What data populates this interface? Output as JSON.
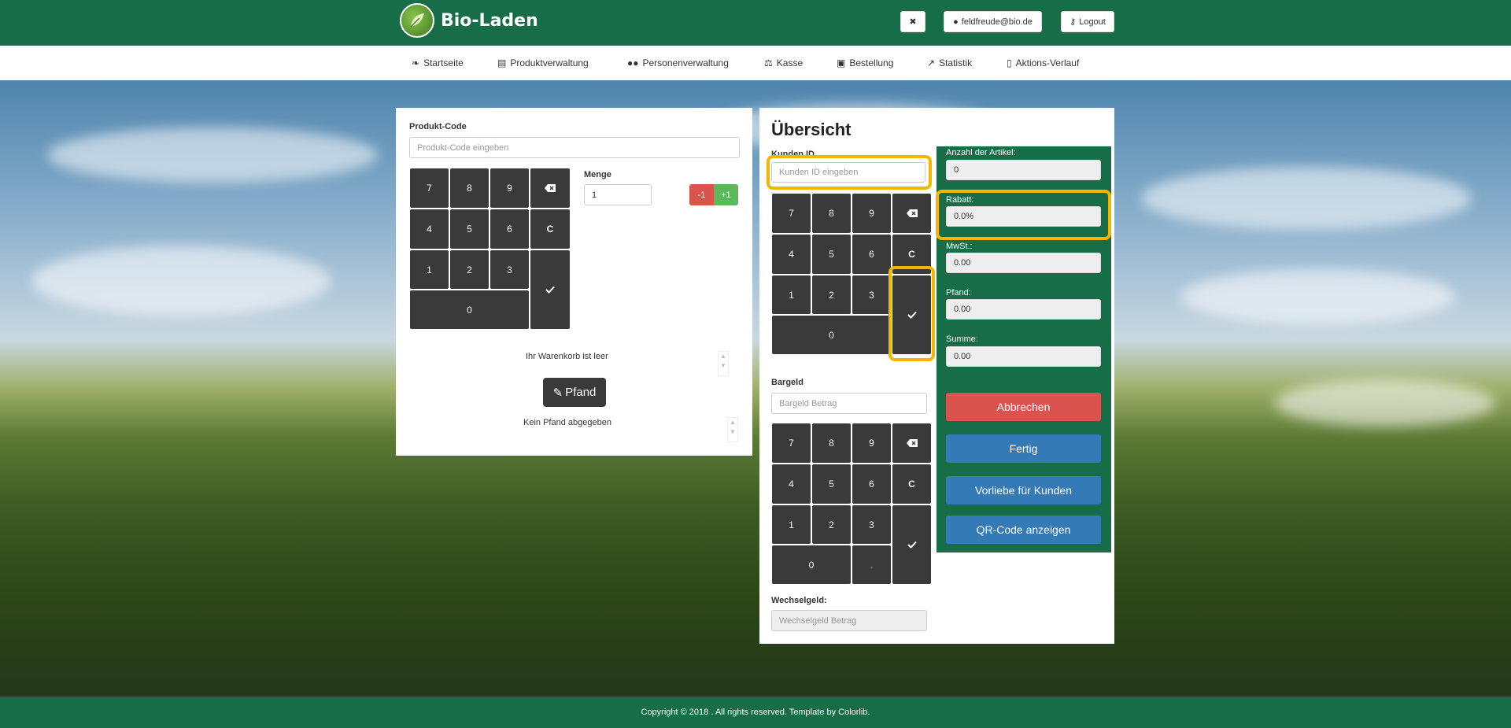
{
  "header": {
    "brand": "Bio-Laden",
    "user_email": "feldfreude@bio.de",
    "logout_label": "Logout"
  },
  "nav": {
    "items": [
      {
        "label": "Startseite",
        "icon": "leaf-icon"
      },
      {
        "label": "Produktverwaltung",
        "icon": "boxes-icon"
      },
      {
        "label": "Personenverwaltung",
        "icon": "users-icon"
      },
      {
        "label": "Kasse",
        "icon": "cash-register-icon"
      },
      {
        "label": "Bestellung",
        "icon": "gift-icon"
      },
      {
        "label": "Statistik",
        "icon": "line-chart-icon"
      },
      {
        "label": "Aktions-Verlauf",
        "icon": "clipboard-icon"
      }
    ]
  },
  "left": {
    "product_code_label": "Produkt-Code",
    "product_code_placeholder": "Produkt-Code eingeben",
    "quantity_label": "Menge",
    "quantity_value": "1",
    "minus_label": "-1",
    "plus_label": "+1",
    "keypad": {
      "k7": "7",
      "k8": "8",
      "k9": "9",
      "k4": "4",
      "k5": "5",
      "k6": "6",
      "kc": "C",
      "k1": "1",
      "k2": "2",
      "k3": "3",
      "k0": "0"
    },
    "cart_empty": "Ihr Warenkorb ist leer",
    "deposit_button": "Pfand",
    "deposit_status": "Kein Pfand abgegeben"
  },
  "mid": {
    "title": "Übersicht",
    "customer_id_label": "Kunden ID",
    "customer_id_placeholder": "Kunden ID eingeben",
    "keypad": {
      "k7": "7",
      "k8": "8",
      "k9": "9",
      "k4": "4",
      "k5": "5",
      "k6": "6",
      "kc": "C",
      "k1": "1",
      "k2": "2",
      "k3": "3",
      "k0": "0"
    },
    "cash_label": "Bargeld",
    "cash_placeholder": "Bargeld Betrag",
    "cash_keypad": {
      "k7": "7",
      "k8": "8",
      "k9": "9",
      "k4": "4",
      "k5": "5",
      "k6": "6",
      "kc": "C",
      "k1": "1",
      "k2": "2",
      "k3": "3",
      "k0": "0",
      "kdot": "."
    },
    "change_label": "Wechselgeld:",
    "change_placeholder": "Wechselgeld Betrag"
  },
  "summary": {
    "items_label": "Anzahl der Artikel:",
    "items_value": "0",
    "discount_label": "Rabatt:",
    "discount_value": "0.0%",
    "vat_label": "MwSt.:",
    "vat_value": "0.00",
    "deposit_label": "Pfand:",
    "deposit_value": "0.00",
    "sum_label": "Summe:",
    "sum_value": "0.00",
    "cancel_button": "Abbrechen",
    "done_button": "Fertig",
    "preference_button": "Vorliebe für Kunden",
    "qr_button": "QR-Code anzeigen"
  },
  "footer": {
    "text": "Copyright © 2018 . All rights reserved. Template by Colorlib."
  },
  "colors": {
    "brand_green": "#176d48",
    "key_dark": "#3a3a3a",
    "danger": "#d9534f",
    "primary": "#337ab7",
    "success": "#5cb85c",
    "highlight": "#f5b500"
  }
}
